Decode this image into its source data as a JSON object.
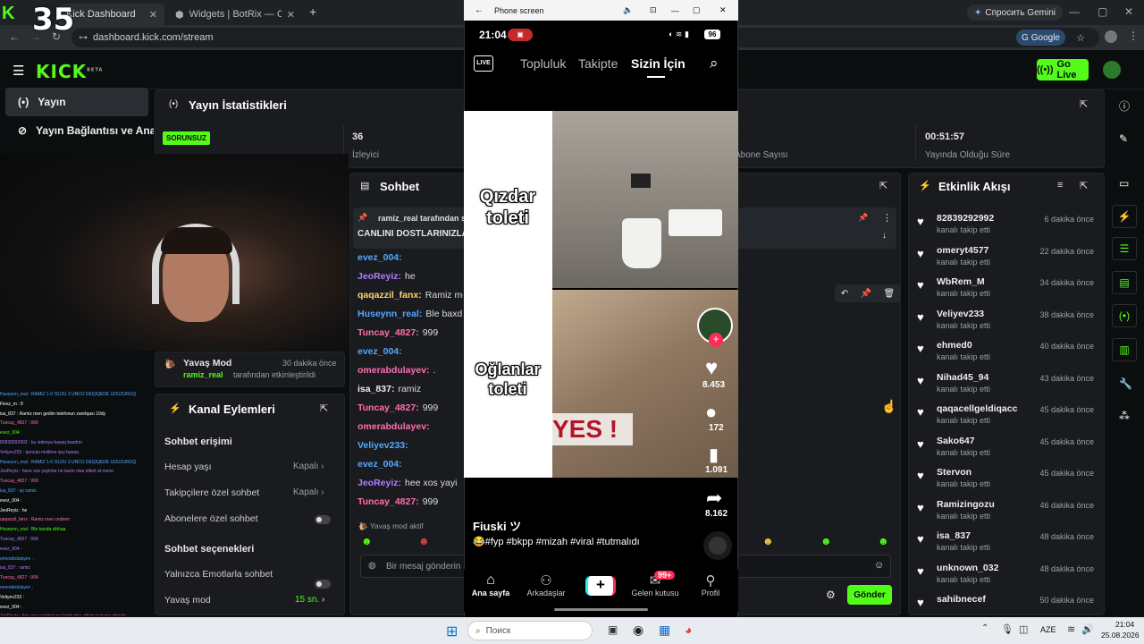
{
  "browser": {
    "tabs": [
      {
        "label": "Kick Dashboard"
      },
      {
        "label": "Widgets | BotRix — Cloud Strea"
      }
    ],
    "new_tab": "+",
    "url": "dashboard.kick.com/stream",
    "gemini": "Спросить Gemini",
    "google_btn": "Google",
    "overlay_number": "35"
  },
  "kick": {
    "logo": "KICK",
    "logo_beta": "BETA",
    "go_live": "Go Live",
    "nav": [
      {
        "label": "Yayın"
      },
      {
        "label": "Yayın Bağlantısı ve Anahtarı"
      }
    ]
  },
  "stats": {
    "title": "Yayın İstatistikleri",
    "status_badge": "SORUNSUZ",
    "viewers_value": "36",
    "viewers_label": "İzleyici",
    "subs_label": "Abone Sayısı",
    "duration_value": "00:51:57",
    "duration_label": "Yayında Olduğu Süre"
  },
  "slow_mode_notice": {
    "title": "Yavaş Mod",
    "time": "30 dakika önce",
    "user": "ramiz_real",
    "text": "tarafından etkinleştirildi"
  },
  "channel_actions": {
    "title": "Kanal Eylemleri",
    "chat_access": "Sohbet erişimi",
    "account_age": "Hesap yaşı",
    "account_age_value": "Kapalı",
    "followers_only": "Takipçilere özel sohbet",
    "followers_only_value": "Kapalı",
    "subs_only": "Abonelere özel sohbet",
    "chat_options": "Sohbet seçenekleri",
    "emotes_only": "Yalnızca Emotlarla sohbet",
    "slow_mode": "Yavaş mod",
    "slow_mode_value": "15 sn."
  },
  "chat": {
    "title": "Sohbet",
    "pinned_user": "ramiz_real tarafından sa",
    "pinned_text": "CANLINI DOSTLARINIZLA",
    "messages": [
      {
        "user": "evez_004:",
        "text": "",
        "color": "#53a8ff"
      },
      {
        "user": "JeoReyiz:",
        "text": "he",
        "color": "#b07cff"
      },
      {
        "user": "qaqazzil_fanx:",
        "text": "Ramiz men",
        "color": "#ffd36b"
      },
      {
        "user": "Huseynn_real:",
        "text": "Ble baxd",
        "color": "#53a8ff"
      },
      {
        "user": "Tuncay_4827:",
        "text": "999",
        "color": "#ff6fae"
      },
      {
        "user": "evez_004:",
        "text": "",
        "color": "#53a8ff"
      },
      {
        "user": "omerabdulayev:",
        "text": ".",
        "color": "#ff6fae"
      },
      {
        "user": "isa_837:",
        "text": "ramiz",
        "color": "#eeeeee"
      },
      {
        "user": "Tuncay_4827:",
        "text": "999",
        "color": "#ff6fae"
      },
      {
        "user": "omerabdulayev:",
        "text": "",
        "color": "#ff6fae"
      },
      {
        "user": "Veliyev233:",
        "text": "",
        "color": "#53a8ff"
      },
      {
        "user": "evez_004:",
        "text": "",
        "color": "#53a8ff"
      },
      {
        "user": "JeoReyiz:",
        "text": "hee xos yayi",
        "color": "#b07cff"
      },
      {
        "user": "Tuncay_4827:",
        "text": "999",
        "color": "#ff6fae"
      }
    ],
    "slow_mode_active": "Yavaş mod aktif",
    "input_placeholder": "Bir mesaj gönderin",
    "send": "Gönder"
  },
  "activity": {
    "title": "Etkinlik Akışı",
    "items": [
      {
        "name": "82839292992",
        "sub": "kanalı takip etti",
        "time": "6 dakika önce"
      },
      {
        "name": "omeryt4577",
        "sub": "kanalı takip etti",
        "time": "22 dakika önce"
      },
      {
        "name": "WbRem_M",
        "sub": "kanalı takip etti",
        "time": "34 dakika önce"
      },
      {
        "name": "Veliyev233",
        "sub": "kanalı takip etti",
        "time": "38 dakika önce"
      },
      {
        "name": "ehmed0",
        "sub": "kanalı takip etti",
        "time": "40 dakika önce"
      },
      {
        "name": "Nihad45_94",
        "sub": "kanalı takip etti",
        "time": "43 dakika önce"
      },
      {
        "name": "qaqacellgeldiqacc",
        "sub": "kanalı takip etti",
        "time": "45 dakika önce"
      },
      {
        "name": "Sako647",
        "sub": "kanalı takip etti",
        "time": "45 dakika önce"
      },
      {
        "name": "Stervon",
        "sub": "kanalı takip etti",
        "time": "45 dakika önce"
      },
      {
        "name": "Ramizingozu",
        "sub": "kanalı takip etti",
        "time": "46 dakika önce"
      },
      {
        "name": "isa_837",
        "sub": "kanalı takip etti",
        "time": "48 dakika önce"
      },
      {
        "name": "unknown_032",
        "sub": "kanalı takip etti",
        "time": "48 dakika önce"
      },
      {
        "name": "sahibnecef",
        "sub": "",
        "time": "50 dakika önce"
      }
    ]
  },
  "phone": {
    "window_title": "Phone screen",
    "time": "21:04",
    "battery": "96",
    "tabs": [
      "Topluluk",
      "Takipte",
      "Sizin İçin"
    ],
    "live_label": "LIVE",
    "caption_top": "Qızdar toleti",
    "caption_bottom": "Oğlanlar toleti",
    "yes_text": "YES !",
    "likes": "8.453",
    "comments": "172",
    "saves": "1.091",
    "shares": "8.162",
    "author": "Fiuski ツ",
    "description": "😂#fyp #bkpp #mizah #viral #tutmalıdı",
    "bottom_nav": [
      "Ana sayfa",
      "Arkadaşlar",
      "+",
      "Gelen kutusu",
      "Profil"
    ],
    "inbox_badge": "99+"
  },
  "overlay_chat": [
    "Huseynn_real : RAMIZ 1-0 OLDU 3 UNCU DEQIQEDE UDUZURUQ",
    "Fiesz_m : 8",
    "isa_837 : Ramiz men gedim telefonun zaretqası 10dy",
    "Tuncay_4827 : 999",
    "evez_004 :",
    "82839292992 : bu videoya bayaq baxdım",
    "Veliyev233 : qorxulu mollimə qoy baxaq",
    "Huseynn_real : RAMIZ 1-0 OLDU 3 UNCU DEQIQEDE UDUZURUQ",
    "JeoReyiz : heee xos yayinlar ne lazim olsa etiket at mene",
    "Tuncay_4827 : 999",
    "isa_837 : ay ramiz",
    "evez_004 :",
    "JeoReyiz : he",
    "qaqazzil_fanx : Ramiz men cedrem",
    "Huseynn_real : Ble baxda sibhaa",
    "Tuncay_4827 : 999",
    "evez_004 :",
    "omerabdulayev : .",
    "isa_837 : ramiz",
    "Tuncay_4827 : 999",
    "omerabdulayev :",
    "Veliyev233 :",
    "evez_004 :",
    "JeoReyiz : hee xos yayinlar ne lazim olsa etiket at mene chırıda",
    "Tuncay_4827 : 999"
  ],
  "taskbar": {
    "search": "Поиск",
    "lang": "AZE",
    "time": "21:04",
    "date": "25.08.2026"
  },
  "colors": {
    "kick_green": "#53fc18",
    "panel_bg": "#191b1f",
    "page_bg": "#0b0e0f"
  }
}
